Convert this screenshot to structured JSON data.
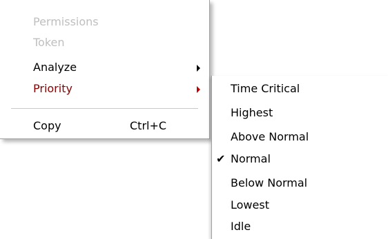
{
  "main_menu": {
    "items": [
      {
        "label": "Permissions",
        "state": "disabled"
      },
      {
        "label": "Token",
        "state": "disabled"
      },
      {
        "label": "Analyze",
        "state": "normal",
        "submenu": true
      },
      {
        "label": "Priority",
        "state": "highlighted",
        "submenu": true
      },
      {
        "label": "Copy",
        "shortcut": "Ctrl+C",
        "state": "normal"
      }
    ]
  },
  "priority_menu": {
    "items": [
      {
        "label": "Time Critical"
      },
      {
        "label": "Highest"
      },
      {
        "label": "Above Normal"
      },
      {
        "label": "Normal",
        "checked": true
      },
      {
        "label": "Below Normal"
      },
      {
        "label": "Lowest"
      },
      {
        "label": "Idle"
      }
    ]
  },
  "icons": {
    "submenu_arrow": "triangle-right-icon",
    "check_mark": "✔"
  },
  "colors": {
    "disabled_text": "#bfbfbf",
    "highlighted_text": "#8b0000",
    "highlighted_arrow": "#c00000"
  }
}
